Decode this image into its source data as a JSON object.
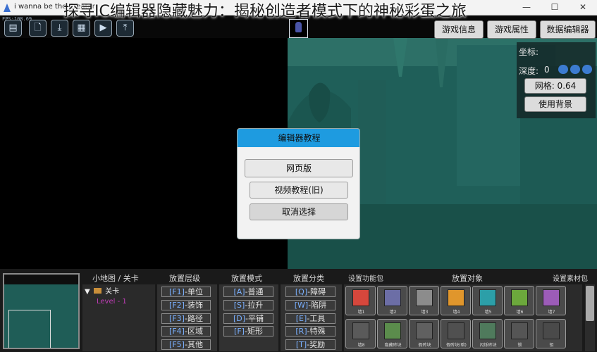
{
  "window": {
    "title": "i wanna be the Creator",
    "overlay_title": "探寻IC编辑器隐藏魅力：揭秘创造者模式下的神秘彩蛋之旅",
    "fps_text": "FPS:108.69",
    "controls": [
      "—",
      "☐",
      "✕"
    ]
  },
  "toolbar": {
    "icons": [
      "folder-icon",
      "new-file-icon",
      "download-icon",
      "save-icon",
      "play-icon",
      "upload-icon"
    ],
    "glyphs": [
      "▤",
      "🗋",
      "⤓",
      "▦",
      "▶",
      "⤒"
    ]
  },
  "top_right": {
    "game_info": "游戏信息",
    "game_props": "游戏属性",
    "data_editor": "数据编辑器"
  },
  "info_panel": {
    "coord_label": "坐标:",
    "depth_label": "深度:",
    "depth_value": "0",
    "grid_label": "网格: 0.64",
    "use_bg": "使用背景"
  },
  "dialog": {
    "title": "编辑器教程",
    "web_version": "网页版",
    "video_tutorial": "视频教程(旧)",
    "cancel": "取消选择"
  },
  "bottom": {
    "minimap_header": "小地图 / 关卡",
    "layer_header": "放置层级",
    "mode_header": "放置模式",
    "category_header": "放置分类",
    "pack_header": "设置功能包",
    "object_header": "放置对象",
    "material_header": "设置素材包",
    "tree_root": "关卡",
    "tree_level": "Level - 1",
    "layers": [
      {
        "key": "[F1]",
        "text": "-单位"
      },
      {
        "key": "[F2]",
        "text": "-装饰"
      },
      {
        "key": "[F3]",
        "text": "-路径"
      },
      {
        "key": "[F4]",
        "text": "-区域"
      },
      {
        "key": "[F5]",
        "text": "-其他"
      }
    ],
    "modes": [
      {
        "key": "[A]",
        "text": "-普通"
      },
      {
        "key": "[S]",
        "text": "-拉升"
      },
      {
        "key": "[D]",
        "text": "-平铺"
      },
      {
        "key": "[F]",
        "text": "-矩形"
      }
    ],
    "categories": [
      {
        "key": "[Q]",
        "text": "-障碍"
      },
      {
        "key": "[W]",
        "text": "-陷阱"
      },
      {
        "key": "[E]",
        "text": "-工具"
      },
      {
        "key": "[R]",
        "text": "-特殊"
      },
      {
        "key": "[T]",
        "text": "-奖励"
      }
    ],
    "tiles_row1": [
      {
        "label": "墙1",
        "color": "#d6473c"
      },
      {
        "label": "墙2",
        "color": "#6c6ea6"
      },
      {
        "label": "墙3",
        "color": "#8c8c8c"
      },
      {
        "label": "墙4",
        "color": "#e0962c"
      },
      {
        "label": "墙5",
        "color": "#2c9fa8"
      },
      {
        "label": "墙6",
        "color": "#6ca83c"
      },
      {
        "label": "墙7",
        "color": "#9c5cb8"
      }
    ],
    "tiles_row2": [
      {
        "label": "墙8",
        "color": "#5a5a5a"
      },
      {
        "label": "隐藏砖块",
        "color": "#5b8c4c"
      },
      {
        "label": "假砖块",
        "color": "#606060"
      },
      {
        "label": "假砖块(暗)",
        "color": "#505050"
      },
      {
        "label": "闪烁砖块",
        "color": "#4f7a5c"
      },
      {
        "label": "锁",
        "color": "#555"
      },
      {
        "label": "钥",
        "color": "#4a4a4a"
      }
    ]
  }
}
